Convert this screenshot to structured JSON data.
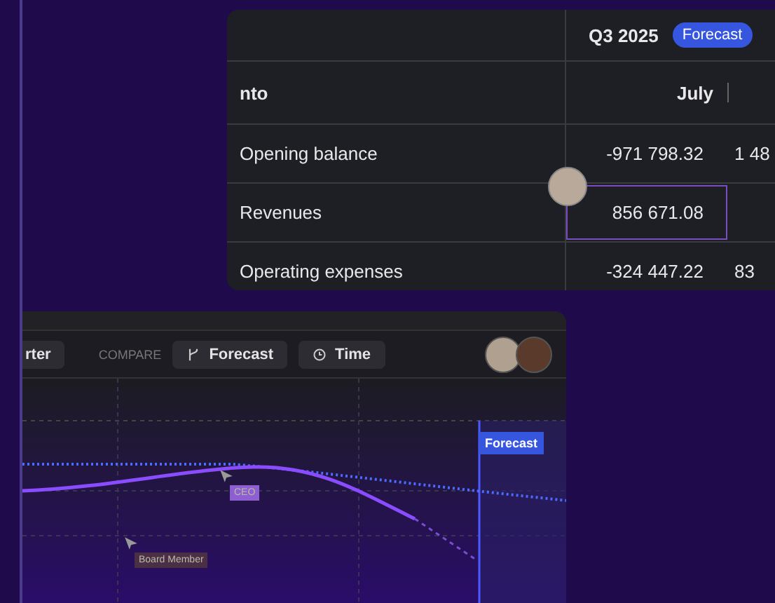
{
  "table": {
    "quarter": "Q3 2025",
    "quarter_badge": "Forecast",
    "label_header": "nto",
    "month": "July",
    "rows": [
      {
        "label": "Opening balance",
        "value": "-971 798.32",
        "next": "1 48",
        "highlighted": false
      },
      {
        "label": "Revenues",
        "value": "856 671.08",
        "next": "",
        "highlighted": true
      },
      {
        "label": "Operating expenses",
        "value": "-324 447.22",
        "next": "83",
        "highlighted": false
      }
    ]
  },
  "toolbar": {
    "partial_button": "rter",
    "compare_label": "COMPARE",
    "buttons": [
      {
        "kind": "branch",
        "label": "Forecast"
      },
      {
        "kind": "clock",
        "label": "Time"
      }
    ]
  },
  "chart": {
    "forecast_tag": "Forecast",
    "cursors": [
      {
        "label": "CEO",
        "color": "#8e5fd0"
      },
      {
        "label": "Board Member",
        "color": "#4a2f45"
      }
    ]
  }
}
